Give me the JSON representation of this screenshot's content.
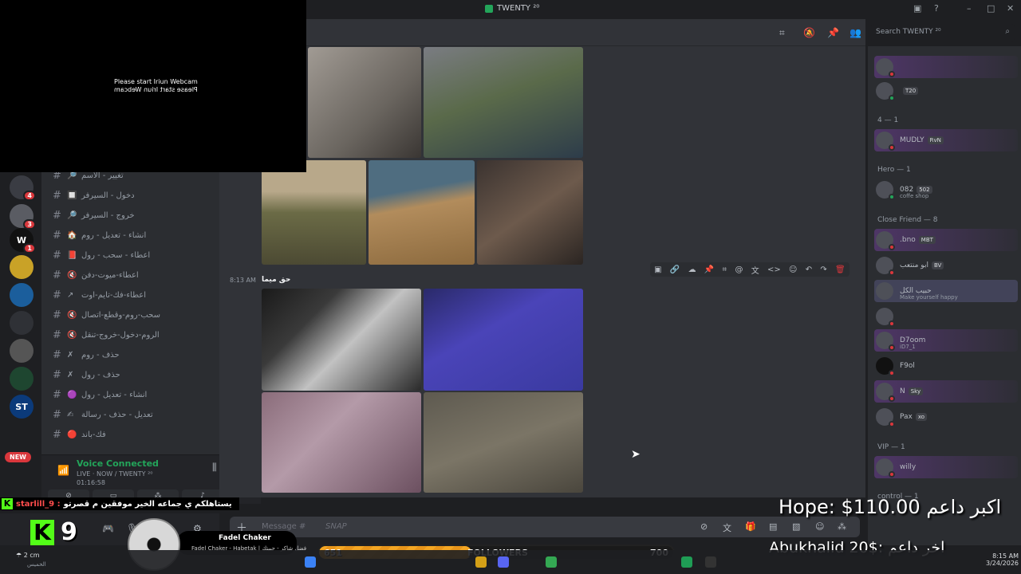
{
  "window": {
    "title": "TWENTY ²⁰"
  },
  "header": {
    "search_placeholder": "Search TWENTY ²⁰"
  },
  "channels": [
    {
      "name": "تغيير - الأسم",
      "icon": "🔎"
    },
    {
      "name": "دخول - السيرفر",
      "icon": "🔲"
    },
    {
      "name": "خروج - السيرفر",
      "icon": "🔎"
    },
    {
      "name": "انشاء - تعديل - روم",
      "icon": "🏠"
    },
    {
      "name": "اعطاء - سحب - رول",
      "icon": "📕"
    },
    {
      "name": "اعطاء-ميوت-دفن",
      "icon": "🔇"
    },
    {
      "name": "اعطاء-فك-تايم-اوت",
      "icon": "↗"
    },
    {
      "name": "سحب-روم-وقطع-اتصال",
      "icon": "🔇"
    },
    {
      "name": "الروم-دخول-خروج-تنقل",
      "icon": "🔇"
    },
    {
      "name": "حذف - روم",
      "icon": "✗"
    },
    {
      "name": "حذف - رول",
      "icon": "✗"
    },
    {
      "name": "انشاء - تعديل - رول",
      "icon": "🟣"
    },
    {
      "name": "تعديل - حذف - رسالة",
      "icon": "✍"
    },
    {
      "name": "فك-باند",
      "icon": "🔴"
    }
  ],
  "servers": [
    {
      "label": "",
      "badge": "4"
    },
    {
      "label": "",
      "badge": "3"
    },
    {
      "label": "W",
      "badge": "1"
    },
    {
      "label": "",
      "badge": ""
    },
    {
      "label": "",
      "badge": ""
    },
    {
      "label": "",
      "badge": ""
    },
    {
      "label": "",
      "badge": ""
    },
    {
      "label": "",
      "badge": ""
    },
    {
      "label": "ST",
      "badge": ""
    }
  ],
  "new_pill": "NEW",
  "voice": {
    "status": "Voice Connected",
    "channel": "LIVE · NOW / TWENTY ²⁰",
    "time": "01:16:58"
  },
  "message": {
    "time": "8:13 AM",
    "author": "حق ميما"
  },
  "composer": {
    "placeholder": "Message #",
    "snap": "SNAP"
  },
  "members": [
    {
      "name": "",
      "tag": "",
      "sub": ""
    },
    {
      "name": "",
      "tag": "T20",
      "sub": ""
    },
    {
      "role": "4 — 1"
    },
    {
      "name": "MUDLY",
      "tag": "RvN",
      "sub": ""
    },
    {
      "role": "Hero — 1"
    },
    {
      "name": "082",
      "tag": "502",
      "sub": "coffe shop"
    },
    {
      "role": "Close Friend — 8"
    },
    {
      "name": ".bno",
      "tag": "MBT",
      "sub": ""
    },
    {
      "name": "ابو منتعب",
      "tag": "BV",
      "sub": ""
    },
    {
      "name": "حبيب الكل",
      "tag": "",
      "sub": "Make yourself happy"
    },
    {
      "name": "",
      "tag": "",
      "sub": ""
    },
    {
      "name": "D7oom",
      "tag": "",
      "sub": "iD7_1"
    },
    {
      "name": "F9ol",
      "tag": "",
      "sub": ""
    },
    {
      "name": "N",
      "tag": "Sky",
      "sub": ""
    },
    {
      "name": "Pax",
      "tag": "xo",
      "sub": ""
    },
    {
      "role": "VIP — 1"
    },
    {
      "name": "willy",
      "tag": "",
      "sub": ""
    },
    {
      "role": "control — 1"
    }
  ],
  "webcam": {
    "line1": "Please start Iriun Webcam",
    "line2": "Please start Iriun Webcam"
  },
  "overlay": {
    "ticker_user": "starlill_9 :",
    "ticker_msg": "يستاهلكم ي جماعه الخير موفقين م قصرتو",
    "kick_letter": "K",
    "kick_count": "9",
    "song_title": "Fadel Chaker",
    "song_artist": "Fadel Chaker - Habetak | فضل شاكر - حبيتك",
    "followers_label": "FOLLOWERS",
    "followers_current": "651",
    "followers_goal": "700",
    "followers_progress": 0.43,
    "top_donor": "Hope: $110.00 اكبر داعم",
    "last_donor": "Abukhalid 20$: اخر داعم"
  },
  "taskbar": {
    "weather_temp": "2 cm",
    "weather_label": "الخميس",
    "time": "8:15 AM",
    "date": "3/24/2026"
  }
}
